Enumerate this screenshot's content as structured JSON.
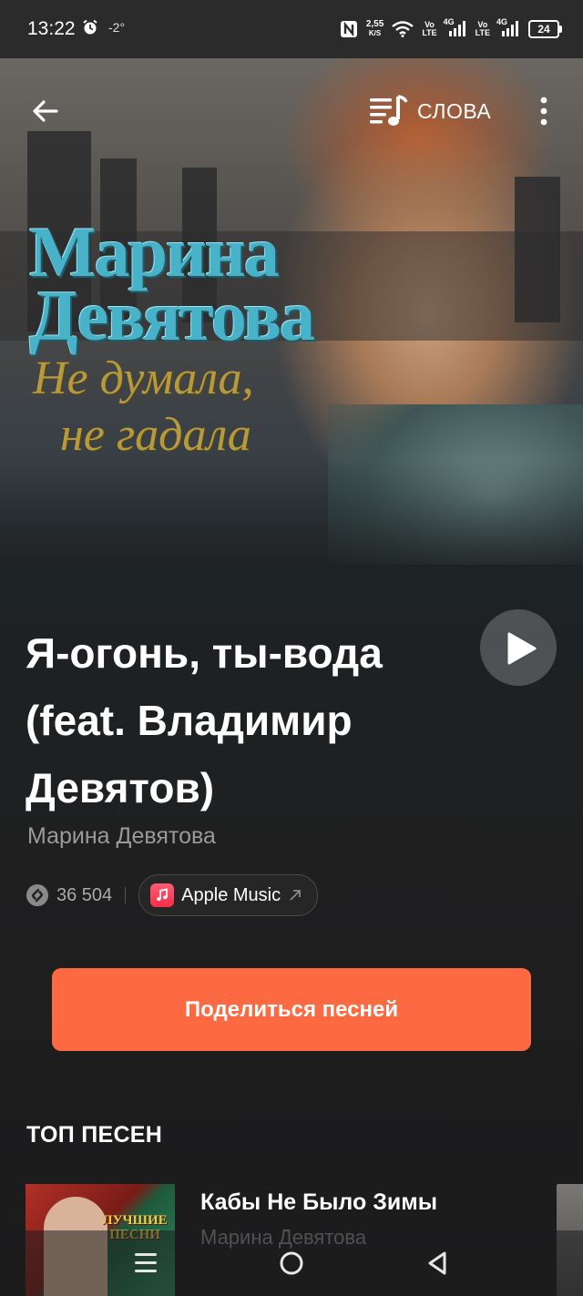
{
  "status_bar": {
    "time": "13:22",
    "temperature": "-2°",
    "net_speed_value": "2,55",
    "net_speed_unit": "K/S",
    "sim1_tag_top": "Vo",
    "sim1_tag_bottom": "LTE",
    "sim1_gen": "4G",
    "sim2_tag_top": "Vo",
    "sim2_tag_bottom": "LTE",
    "sim2_gen": "4G",
    "battery": "24"
  },
  "header": {
    "lyrics_label": "СЛОВА"
  },
  "cover": {
    "artist_line1": "Марина",
    "artist_line2": "Девятова",
    "album_line1": "Не думала,",
    "album_line2": "не гадала"
  },
  "song": {
    "title": "Я-огонь, ты-вода (feat. Владимир Девятов)",
    "artist": "Марина Девятова",
    "shazam_count": "36 504",
    "apple_music_label": "Apple Music"
  },
  "share_button_label": "Поделиться песней",
  "top_songs": {
    "title": "ТОП ПЕСЕН",
    "items": [
      {
        "name": "Кабы Не Было Зимы",
        "artist": "Марина Девятова",
        "thumb_text": "Лучшие песни"
      }
    ]
  },
  "colors": {
    "accent": "#fd6a42",
    "background": "#1b1b1c",
    "secondary_text": "#9a9a9a"
  },
  "icons": {
    "back": "arrow-left-icon",
    "lyrics": "lyrics-icon",
    "more": "more-vertical-icon",
    "play": "play-icon",
    "shazam": "shazam-icon",
    "apple_music": "apple-music-icon",
    "external": "external-link-icon"
  }
}
